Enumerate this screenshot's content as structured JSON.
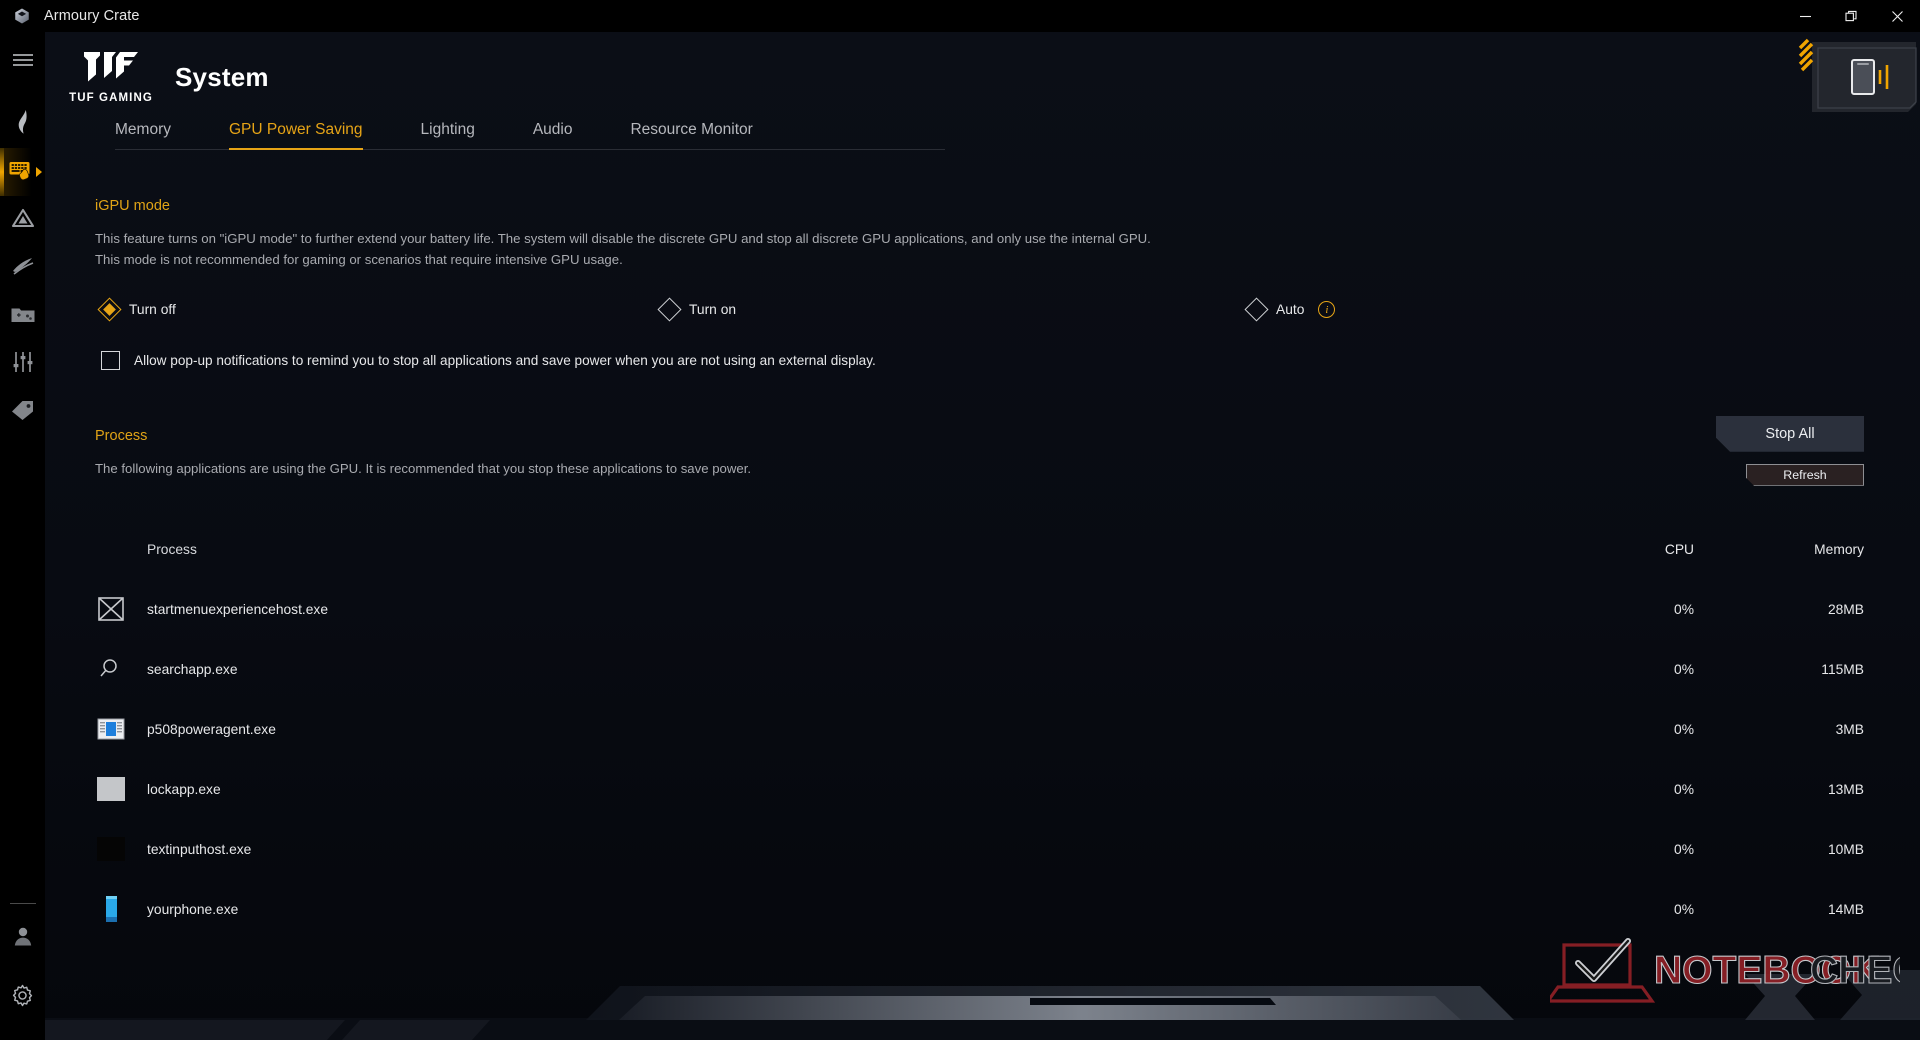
{
  "window": {
    "app_title": "Armoury Crate",
    "app_logo_icon": "armoury-crate-logo",
    "minimize_label": "Minimize",
    "restore_label": "Restore",
    "close_label": "Close"
  },
  "sidebar": {
    "items": [
      {
        "icon": "hamburger-menu-icon",
        "label": "Menu"
      },
      {
        "icon": "aura-flame-icon",
        "label": "Aura"
      },
      {
        "icon": "keyboard-hand-icon",
        "label": "System",
        "active": true
      },
      {
        "icon": "triangle-outline-icon",
        "label": "Scenario Profiles"
      },
      {
        "icon": "fan-blade-icon",
        "label": "Fan Profiles"
      },
      {
        "icon": "game-library-icon",
        "label": "Game Library"
      },
      {
        "icon": "sliders-icon",
        "label": "Settings Sliders"
      },
      {
        "icon": "tag-icon",
        "label": "Featured"
      }
    ],
    "bottom_items": [
      {
        "icon": "user-account-icon",
        "label": "User Account"
      },
      {
        "icon": "gear-icon",
        "label": "Settings"
      }
    ]
  },
  "header": {
    "brand_logo_icon": "tuf-gaming-logo",
    "brand_word": "TUF GAMING",
    "page_title": "System",
    "device_widget_icon": "device-phone-icon"
  },
  "tabs": [
    {
      "label": "Memory",
      "active": false
    },
    {
      "label": "GPU Power Saving",
      "active": true
    },
    {
      "label": "Lighting",
      "active": false
    },
    {
      "label": "Audio",
      "active": false
    },
    {
      "label": "Resource Monitor",
      "active": false
    }
  ],
  "igpu": {
    "title": "iGPU mode",
    "description_line1": "This feature turns on \"iGPU mode\" to further extend your battery life. The system will disable the discrete GPU and stop all discrete GPU applications, and only use the internal GPU.",
    "description_line2": "This mode is not recommended for gaming or scenarios that require intensive GPU usage.",
    "options": [
      {
        "label": "Turn off",
        "selected": true
      },
      {
        "label": "Turn on",
        "selected": false
      },
      {
        "label": "Auto",
        "selected": false
      }
    ],
    "info_icon": "info-icon",
    "info_glyph": "i",
    "checkbox_label": "Allow pop-up notifications to remind you to stop all applications and save power when you are not using an external display.",
    "checkbox_checked": false
  },
  "process": {
    "title": "Process",
    "description": "The following applications are using the GPU. It is recommended that you stop these applications to save power.",
    "stop_all_label": "Stop All",
    "refresh_label": "Refresh",
    "columns": {
      "process": "Process",
      "cpu": "CPU",
      "memory": "Memory"
    },
    "rows": [
      {
        "icon": "crossed-box-icon",
        "name": "startmenuexperiencehost.exe",
        "cpu": "0%",
        "memory": "28MB"
      },
      {
        "icon": "magnifier-icon",
        "name": "searchapp.exe",
        "cpu": "0%",
        "memory": "115MB"
      },
      {
        "icon": "window-panel-icon",
        "name": "p508poweragent.exe",
        "cpu": "0%",
        "memory": "3MB"
      },
      {
        "icon": "gray-square-icon",
        "name": "lockapp.exe",
        "cpu": "0%",
        "memory": "13MB"
      },
      {
        "icon": "black-square-icon",
        "name": "textinputhost.exe",
        "cpu": "0%",
        "memory": "10MB"
      },
      {
        "icon": "phone-icon",
        "name": "yourphone.exe",
        "cpu": "0%",
        "memory": "14MB"
      }
    ]
  },
  "watermark": {
    "text_bold": "NOTEBOOK",
    "text_light": "CHECK",
    "icon": "notebookcheck-laptop-icon"
  },
  "colors": {
    "accent_gold": "#e6a416",
    "background": "#05070c",
    "sidebar": "#000000",
    "text_primary": "#e7e8ea",
    "text_secondary": "#a9abb0",
    "watermark_red": "#8c2026"
  }
}
